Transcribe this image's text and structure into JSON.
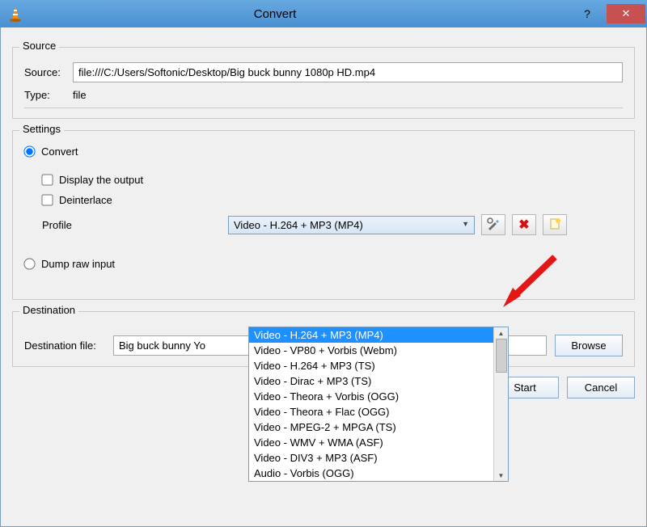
{
  "window": {
    "title": "Convert"
  },
  "source": {
    "legend": "Source",
    "source_label": "Source:",
    "source_value": "file:///C:/Users/Softonic/Desktop/Big buck bunny 1080p HD.mp4",
    "type_label": "Type:",
    "type_value": "file"
  },
  "settings": {
    "legend": "Settings",
    "convert_label": "Convert",
    "display_output_label": "Display the output",
    "deinterlace_label": "Deinterlace",
    "profile_label": "Profile",
    "profile_selected": "Video - H.264 + MP3 (MP4)",
    "dump_label": "Dump raw input",
    "dropdown": [
      "Video - H.264 + MP3 (MP4)",
      "Video - VP80 + Vorbis (Webm)",
      "Video - H.264 + MP3 (TS)",
      "Video - Dirac + MP3 (TS)",
      "Video - Theora + Vorbis (OGG)",
      "Video - Theora + Flac (OGG)",
      "Video - MPEG-2 + MPGA (TS)",
      "Video - WMV + WMA (ASF)",
      "Video - DIV3 + MP3 (ASF)",
      "Audio - Vorbis (OGG)"
    ]
  },
  "destination": {
    "legend": "Destination",
    "file_label": "Destination file:",
    "file_value": "Big buck bunny Yo",
    "browse_label": "Browse"
  },
  "buttons": {
    "start": "Start",
    "cancel": "Cancel"
  }
}
